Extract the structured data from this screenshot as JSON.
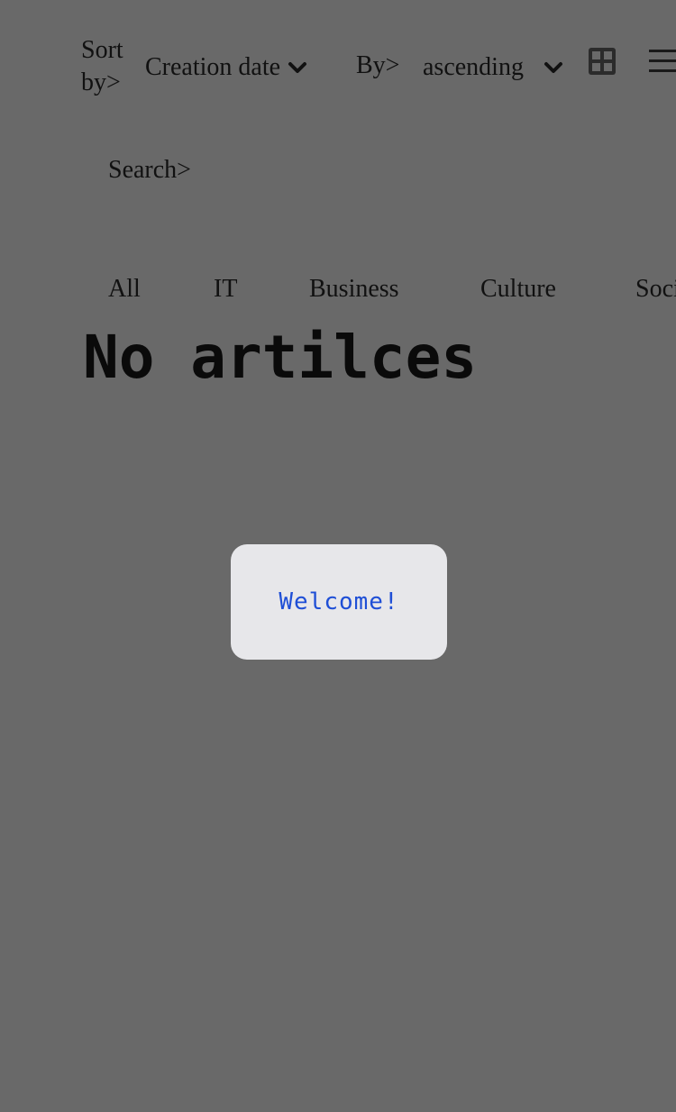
{
  "sort": {
    "label": "Sort by>",
    "field_value": "Creation date",
    "order_label": "By>",
    "order_value": "ascending"
  },
  "view_toggle": {
    "grid_icon": "grid-icon",
    "list_icon": "hamburger-list-icon"
  },
  "search": {
    "label": "Search>",
    "value": "",
    "placeholder": ""
  },
  "tabs": [
    {
      "label": "All"
    },
    {
      "label": "IT"
    },
    {
      "label": "Business"
    },
    {
      "label": "Culture"
    },
    {
      "label": "Society"
    }
  ],
  "empty_state": {
    "title": "No artilces"
  },
  "toast": {
    "text": "Welcome!"
  },
  "colors": {
    "background": "#696969",
    "toast_background": "#e7e7ea",
    "toast_text": "#1f4fd6",
    "text": "#111111"
  }
}
